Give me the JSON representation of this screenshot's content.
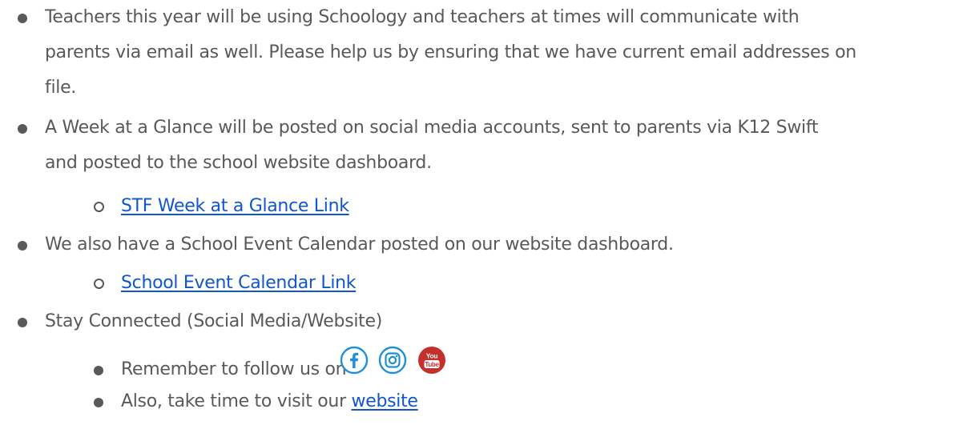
{
  "items": [
    {
      "lines": [
        "Teachers this year will be using Schoology and teachers at times will communicate with",
        "parents via email as well. Please help us by ensuring that we have current email addresses on",
        "file."
      ]
    },
    {
      "lines": [
        "A Week at a Glance will be posted on social media accounts, sent to parents via K12 Swift",
        "and posted to the school website dashboard."
      ],
      "sublink": "STF Week at a Glance Link"
    },
    {
      "lines": [
        "We also have a School Event Calendar posted on our website dashboard."
      ],
      "sublink": "School Event Calendar Link"
    },
    {
      "lines": [
        "Stay Connected (Social Media/Website)"
      ],
      "subitems": [
        {
          "text": "Remember to follow us on "
        },
        {
          "text": "Also, take time to visit our ",
          "link": "website"
        }
      ]
    }
  ],
  "icons": [
    "facebook-icon",
    "instagram-icon",
    "youtube-icon"
  ],
  "youtube_you": "You",
  "youtube_tube": "Tube",
  "colors": {
    "text": "#595959",
    "link": "#1155cc",
    "icon_blue": "#1e90d6",
    "youtube_red": "#c4302b"
  }
}
